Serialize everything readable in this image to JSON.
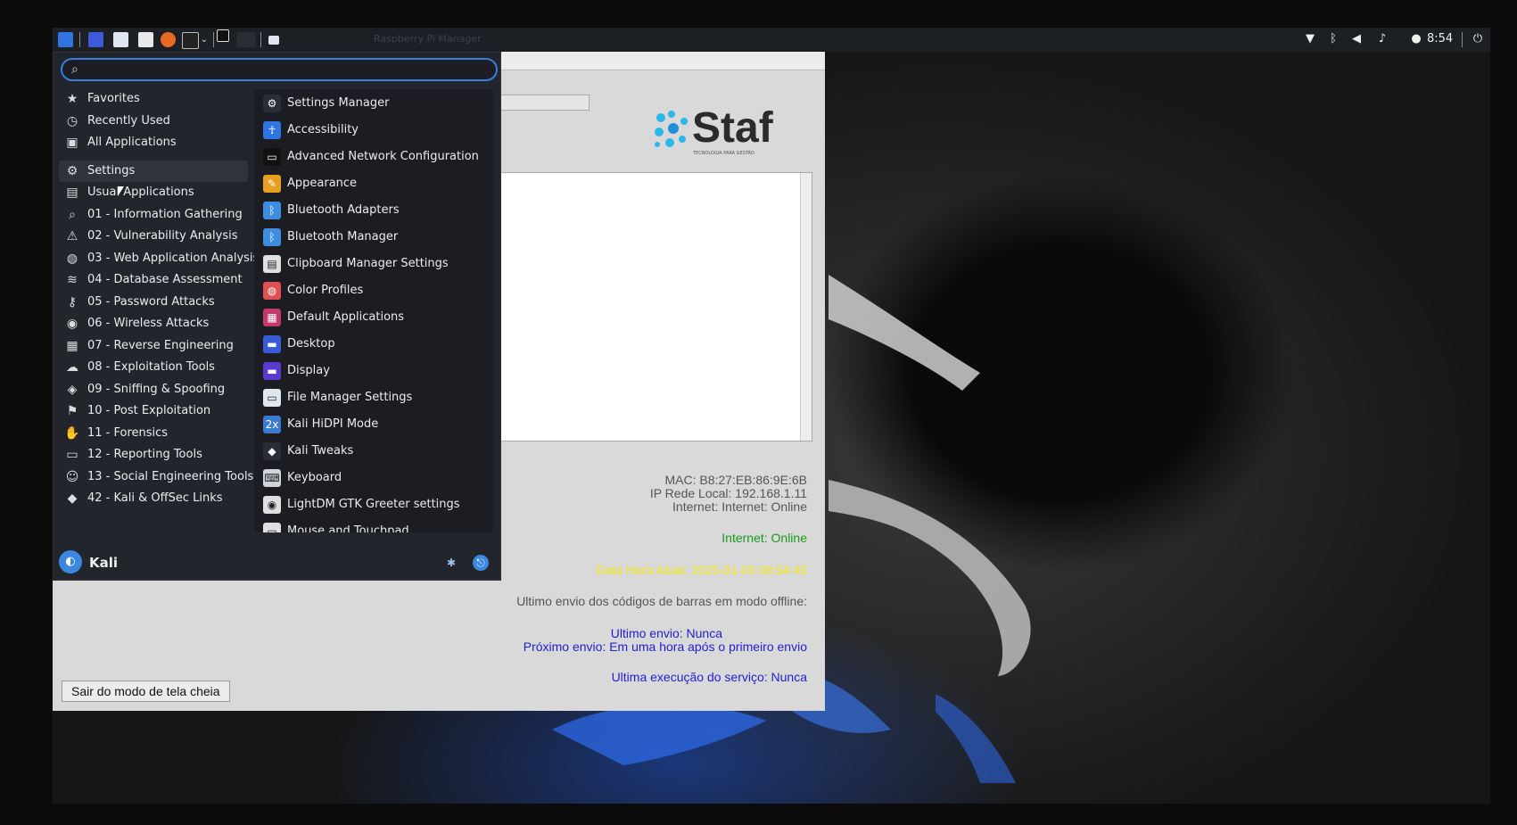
{
  "panel": {
    "window_title": "Raspberry Pi Manager",
    "clock": "8:54",
    "launcher_icons": [
      "kali-menu-icon",
      "desktop-icon",
      "file-manager-icon",
      "text-editor-icon",
      "firefox-icon",
      "terminal-icon",
      "chevron-down-icon",
      "workspace-1-icon",
      "workspace-2-icon",
      "window-button-icon"
    ],
    "tray_icons": [
      "network-icon",
      "bluetooth-icon",
      "volume-icon",
      "notification-icon",
      "power-manager-icon",
      "logout-icon"
    ]
  },
  "menu": {
    "search": {
      "value": "",
      "placeholder": ""
    },
    "categories": [
      {
        "label": "Favorites",
        "icon": "star-icon"
      },
      {
        "label": "Recently Used",
        "icon": "clock-icon"
      },
      {
        "label": "All Applications",
        "icon": "apps-folder-icon"
      },
      {
        "label": "Settings",
        "icon": "settings-icon",
        "active": true
      },
      {
        "label": "Usual Applications",
        "icon": "folder-icon"
      },
      {
        "label": "01 - Information Gathering",
        "icon": "magnifier-icon"
      },
      {
        "label": "02 - Vulnerability Analysis",
        "icon": "vulnerability-icon"
      },
      {
        "label": "03 - Web Application Analysis",
        "icon": "globe-icon"
      },
      {
        "label": "04 - Database Assessment",
        "icon": "database-icon"
      },
      {
        "label": "05 - Password Attacks",
        "icon": "key-icon"
      },
      {
        "label": "06 - Wireless Attacks",
        "icon": "wireless-icon"
      },
      {
        "label": "07 - Reverse Engineering",
        "icon": "reverse-icon"
      },
      {
        "label": "08 - Exploitation Tools",
        "icon": "exploit-icon"
      },
      {
        "label": "09 - Sniffing & Spoofing",
        "icon": "sniff-icon"
      },
      {
        "label": "10 - Post Exploitation",
        "icon": "post-exploit-icon"
      },
      {
        "label": "11 - Forensics",
        "icon": "hand-icon"
      },
      {
        "label": "12 - Reporting Tools",
        "icon": "report-icon"
      },
      {
        "label": "13 - Social Engineering Tools",
        "icon": "social-icon"
      },
      {
        "label": "42 - Kali & OffSec Links",
        "icon": "kali-dragon-icon"
      }
    ],
    "apps": [
      {
        "label": "Settings Manager",
        "icon": "settings-manager-icon",
        "color": "#2a2d33"
      },
      {
        "label": "Accessibility",
        "icon": "accessibility-icon",
        "color": "#2f74e0"
      },
      {
        "label": "Advanced Network Configuration",
        "icon": "network-config-icon",
        "color": "#111111"
      },
      {
        "label": "Appearance",
        "icon": "appearance-icon",
        "color": "#e8a020"
      },
      {
        "label": "Bluetooth Adapters",
        "icon": "bluetooth-icon",
        "color": "#3d8ee0"
      },
      {
        "label": "Bluetooth Manager",
        "icon": "bluetooth-icon",
        "color": "#3d8ee0"
      },
      {
        "label": "Clipboard Manager Settings",
        "icon": "clipboard-icon",
        "color": "#e0e0e0"
      },
      {
        "label": "Color Profiles",
        "icon": "color-profiles-icon",
        "color": "#e05050"
      },
      {
        "label": "Default Applications",
        "icon": "default-apps-icon",
        "color": "#c03a6a"
      },
      {
        "label": "Desktop",
        "icon": "desktop-icon",
        "color": "#3a5bd8"
      },
      {
        "label": "Display",
        "icon": "display-icon",
        "color": "#5a3ad0"
      },
      {
        "label": "File Manager Settings",
        "icon": "file-manager-icon",
        "color": "#dfe6f0"
      },
      {
        "label": "Kali HiDPI Mode",
        "icon": "hidpi-icon",
        "color": "#3a7ad0"
      },
      {
        "label": "Kali Tweaks",
        "icon": "kali-tweaks-icon",
        "color": "#2a2d33"
      },
      {
        "label": "Keyboard",
        "icon": "keyboard-icon",
        "color": "#cfd3da"
      },
      {
        "label": "LightDM GTK Greeter settings",
        "icon": "lightdm-icon",
        "color": "#e0e0e0"
      },
      {
        "label": "Mouse and Touchpad",
        "icon": "mouse-icon",
        "color": "#e0e0e0"
      }
    ],
    "user": {
      "name": "Kali",
      "settings_icon": "settings-icon",
      "logout_icon": "logout-icon"
    }
  },
  "app": {
    "logo_text": "Staf",
    "logo_tagline": "TECNOLOGIA PARA GESTÃO",
    "mac": "MAC: B8:27:EB:86:9E:6B",
    "ip": "IP Rede Local: 192.168.1.11",
    "internet_line": "Internet: Internet: Online",
    "internet_status": "Internet: Online",
    "datetime": "Data Hora Atual: 2025-01-05 08:54:45",
    "barcode_heading": "Ultimo envio dos códigos de barras em modo offline:",
    "last_send": "Ultimo envio: Nunca",
    "next_send": "Próximo envio: Em uma hora após o primeiro envio",
    "last_run": "Ultima execução do serviço: Nunca",
    "exit_fullscreen": "Sair do modo de tela cheia",
    "colors": {
      "online": "#1a9a1a",
      "datetime": "#f0ea10",
      "info": "#555555",
      "send": "#1f1fd0"
    }
  }
}
